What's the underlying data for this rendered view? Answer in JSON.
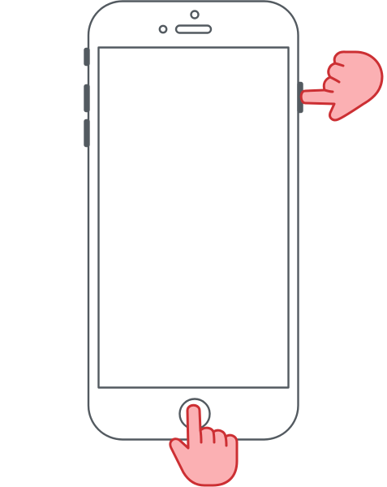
{
  "illustration": {
    "subject": "phone-device",
    "gestures": [
      "press-side-button",
      "press-home-button"
    ],
    "colors": {
      "outline": "#535a60",
      "hand_fill": "#fbb0b3",
      "hand_stroke": "#cc2f33",
      "background": "#ffffff"
    },
    "icons": {
      "side_hand": "pointing-hand-left-icon",
      "home_hand": "pointing-hand-up-icon"
    }
  }
}
